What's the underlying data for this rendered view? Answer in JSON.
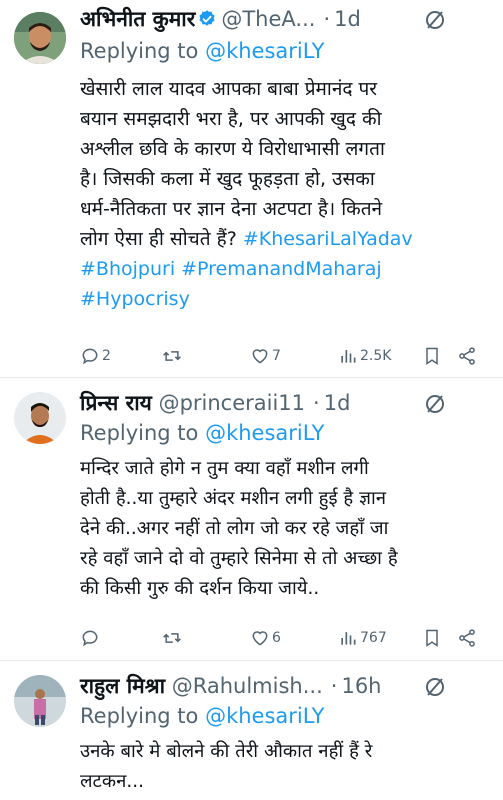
{
  "tweets": [
    {
      "name": "अभिनीत कुमार",
      "handle": "@TheA...",
      "time": "1d",
      "reply_prefix": "Replying to ",
      "reply_mention": "@khesariLY",
      "body_lines": [
        "खेसारी लाल यादव आपका बाबा प्रेमानंद पर",
        "बयान समझदारी भरा है, पर आपकी खुद की",
        "अश्लील छवि के कारण ये विरोधाभासी लगता",
        "है। जिसकी कला में खुद फूहड़ता हो, उसका",
        "धर्म-नैतिकता पर ज्ञान देना अटपटा है। कितने"
      ],
      "line6_text": "लोग ऐसा ही सोचते हैं? ",
      "hashtags": [
        "#KhesariLalYadav",
        "#Bhojpuri",
        "#PremanandMaharaj",
        "#Hypocrisy"
      ],
      "replies": "2",
      "retweets": "",
      "likes": "7",
      "views": "2.5K"
    },
    {
      "name": "प्रिन्स राय",
      "handle": "@princeraii11",
      "time": "1d",
      "reply_prefix": "Replying to ",
      "reply_mention": "@khesariLY",
      "body_lines": [
        "मन्दिर जाते होगे न तुम क्या वहाँ मशीन लगी",
        "होती है..या तुम्हारे अंदर मशीन लगी हुई है ज्ञान",
        "देने की..अगर नहीं तो लोग जो कर रहे जहाँ जा",
        "रहे वहाँ जाने दो वो तुम्हारे सिनेमा से तो अच्छा है",
        "की किसी गुरु की दर्शन किया जाये.."
      ],
      "replies": "",
      "retweets": "",
      "likes": "6",
      "views": "767"
    },
    {
      "name": "राहुल मिश्रा",
      "handle": "@Rahulmish...",
      "time": "16h",
      "reply_prefix": "Replying to ",
      "reply_mention": "@khesariLY",
      "body_lines": [
        "उनके बारे मे बोलने की तेरी औकात नहीं हैं रे",
        "लटकन..."
      ]
    }
  ],
  "colors": {
    "link": "#1d9bf0",
    "secondary": "#536471",
    "text": "#0f1419",
    "divider": "#e6ecf0",
    "verified": "#1d9bf0"
  }
}
